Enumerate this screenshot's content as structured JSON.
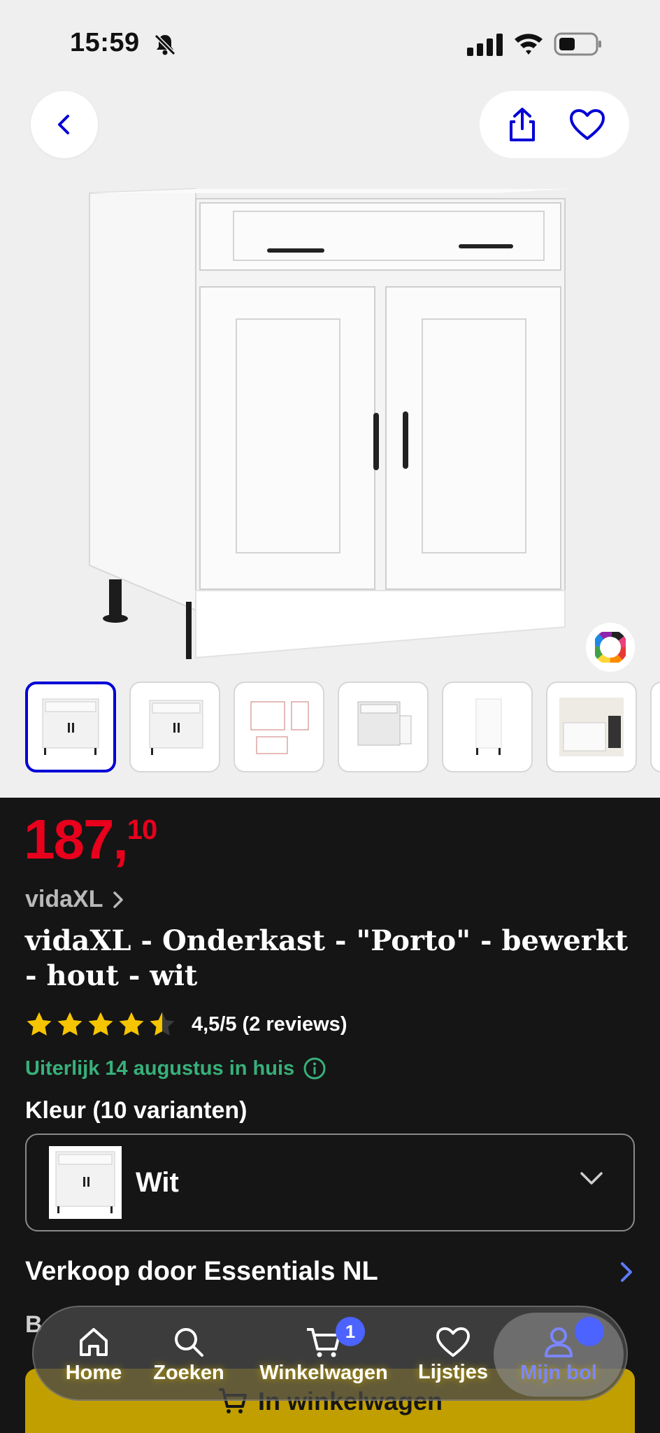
{
  "status_bar": {
    "time": "15:59"
  },
  "product": {
    "price_whole": "187,",
    "price_cents": "10",
    "brand": "vidaXL",
    "title": "vidaXL - Onderkast - \"Porto\" - bewerkt - hout - wit",
    "rating_value": 4.5,
    "rating_text": "4,5/5 (2 reviews)",
    "delivery": "Uiterlijk 14 augustus in huis",
    "color_label": "Kleur (10 varianten)",
    "color_value": "Wit",
    "seller": "Verkoop door Essentials NL",
    "behind_text": "B",
    "add_to_cart": "In winkelwagen",
    "thumbnails": [
      "thumb-1",
      "thumb-2",
      "thumb-3",
      "thumb-4",
      "thumb-5",
      "thumb-6"
    ]
  },
  "tabbar": {
    "home": "Home",
    "search": "Zoeken",
    "cart": "Winkelwagen",
    "cart_badge": "1",
    "lists": "Lijstjes",
    "account": "Mijn bol"
  },
  "colors": {
    "price": "#e8001c",
    "accent_blue": "#0000d6",
    "delivery_green": "#37b07a",
    "cta_yellow": "#c29f00"
  }
}
